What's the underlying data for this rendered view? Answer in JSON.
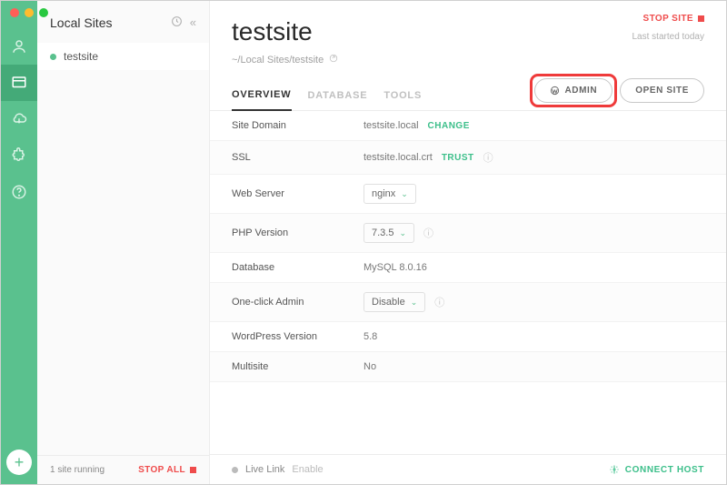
{
  "sidebar": {
    "title": "Local Sites",
    "items": [
      {
        "name": "testsite"
      }
    ],
    "footer": {
      "running_text": "1 site running",
      "stop_all": "STOP ALL"
    }
  },
  "header": {
    "site_name": "testsite",
    "path": "~/Local Sites/testsite",
    "stop_site": "STOP SITE",
    "last_started": "Last started today"
  },
  "tabs": {
    "overview": "OVERVIEW",
    "database": "DATABASE",
    "tools": "TOOLS",
    "admin_btn": "ADMIN",
    "open_site_btn": "OPEN SITE"
  },
  "details": {
    "site_domain_label": "Site Domain",
    "site_domain_value": "testsite.local",
    "change": "CHANGE",
    "ssl_label": "SSL",
    "ssl_value": "testsite.local.crt",
    "trust": "TRUST",
    "web_server_label": "Web Server",
    "web_server_value": "nginx",
    "php_label": "PHP Version",
    "php_value": "7.3.5",
    "db_label": "Database",
    "db_value": "MySQL 8.0.16",
    "oneclick_label": "One-click Admin",
    "oneclick_value": "Disable",
    "wp_label": "WordPress Version",
    "wp_value": "5.8",
    "multisite_label": "Multisite",
    "multisite_value": "No"
  },
  "footer": {
    "live_link": "Live Link",
    "enable": "Enable",
    "connect_host": "CONNECT HOST"
  }
}
